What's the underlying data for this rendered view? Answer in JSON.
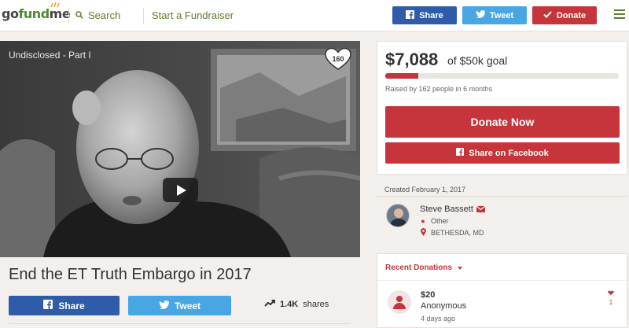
{
  "header": {
    "logo_go": "go",
    "logo_fund": "fund",
    "logo_me": "me",
    "search_label": "Search",
    "start_label": "Start a Fundraiser",
    "share_label": "Share",
    "tweet_label": "Tweet",
    "donate_label": "Donate"
  },
  "video": {
    "title": "Undisclosed - Part I",
    "heart_count": "160"
  },
  "campaign": {
    "title": "End the ET Truth Embargo in 2017",
    "share_label": "Share",
    "tweet_label": "Tweet",
    "shares_count": "1.4K",
    "shares_suffix": "shares"
  },
  "funding": {
    "raised": "$7,088",
    "goal_text": "of $50k goal",
    "progress_fraction": 0.1418,
    "raised_by": "Raised by 162 people in 6 months",
    "donate_now_label": "Donate Now",
    "share_facebook_label": "Share on Facebook"
  },
  "organizer": {
    "created": "Created February 1, 2017",
    "name": "Steve Bassett",
    "category": "Other",
    "location": "BETHESDA, MD"
  },
  "recent_donations": {
    "heading": "Recent Donations",
    "items": [
      {
        "amount": "$20",
        "name": "Anonymous",
        "time": "4 days ago",
        "hearts": "1"
      }
    ]
  },
  "colors": {
    "brand_green": "#5b7e2f",
    "facebook": "#2f5ca8",
    "twitter": "#48a7e3",
    "donate_red": "#c5353b"
  }
}
